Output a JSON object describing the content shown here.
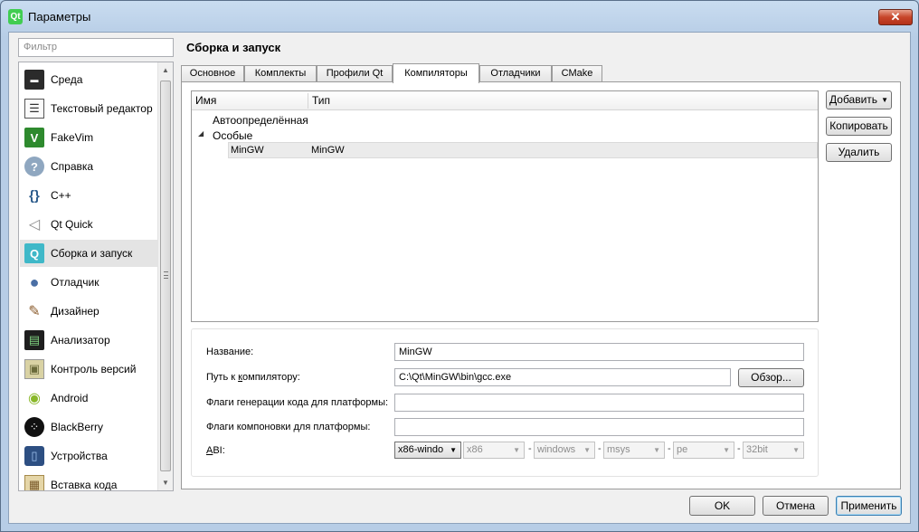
{
  "window": {
    "title": "Параметры",
    "app_icon_text": "Qt",
    "close_glyph": "✕"
  },
  "sidebar": {
    "filter_placeholder": "Фильтр",
    "items": [
      {
        "label": "Среда",
        "icon": "environment-icon",
        "glyph": "▬"
      },
      {
        "label": "Текстовый редактор",
        "icon": "text-editor-icon",
        "glyph": "☰"
      },
      {
        "label": "FakeVim",
        "icon": "fakevim-icon",
        "glyph": "V"
      },
      {
        "label": "Справка",
        "icon": "help-icon",
        "glyph": "?"
      },
      {
        "label": "C++",
        "icon": "cpp-icon",
        "glyph": "{}"
      },
      {
        "label": "Qt Quick",
        "icon": "qt-quick-icon",
        "glyph": "◁"
      },
      {
        "label": "Сборка и запуск",
        "icon": "build-run-icon",
        "glyph": "Q"
      },
      {
        "label": "Отладчик",
        "icon": "debugger-icon",
        "glyph": "●"
      },
      {
        "label": "Дизайнер",
        "icon": "designer-icon",
        "glyph": "✎"
      },
      {
        "label": "Анализатор",
        "icon": "analyzer-icon",
        "glyph": "▤"
      },
      {
        "label": "Контроль версий",
        "icon": "version-control-icon",
        "glyph": "▣"
      },
      {
        "label": "Android",
        "icon": "android-icon",
        "glyph": "◉"
      },
      {
        "label": "BlackBerry",
        "icon": "blackberry-icon",
        "glyph": "⁘"
      },
      {
        "label": "Устройства",
        "icon": "devices-icon",
        "glyph": "▯"
      },
      {
        "label": "Вставка кода",
        "icon": "code-paste-icon",
        "glyph": "▦"
      }
    ]
  },
  "page": {
    "title": "Сборка и запуск",
    "tabs": [
      {
        "label": "Основное"
      },
      {
        "label": "Комплекты"
      },
      {
        "label": "Профили Qt"
      },
      {
        "label": "Компиляторы"
      },
      {
        "label": "Отладчики"
      },
      {
        "label": "CMake"
      }
    ]
  },
  "compilers": {
    "columns": {
      "name": "Имя",
      "type": "Тип"
    },
    "groups": {
      "auto": "Автоопределённая",
      "manual": "Особые"
    },
    "selected_row": {
      "name": "MinGW",
      "type": "MinGW"
    },
    "buttons": {
      "add": "Добавить",
      "copy": "Копировать",
      "remove": "Удалить"
    }
  },
  "details": {
    "name_label": "Название:",
    "name_value": "MinGW",
    "path_label_pre": "Путь к ",
    "path_label_u": "к",
    "path_label_post": "омпилятору:",
    "path_value": "C:\\Qt\\MinGW\\bin\\gcc.exe",
    "browse_label": "Обзор...",
    "platform_codegen_label": "Флаги генерации кода для платформы:",
    "platform_codegen_value": "",
    "platform_linker_label": "Флаги компоновки для платформы:",
    "platform_linker_value": "",
    "abi_label_u": "A",
    "abi_label_rest": "BI:",
    "abi": {
      "main": "x86-windo",
      "arch": "x86",
      "os": "windows",
      "flavor": "msys",
      "format": "pe",
      "width": "32bit"
    }
  },
  "footer": {
    "ok": "OK",
    "cancel": "Отмена",
    "apply": "Применить"
  }
}
